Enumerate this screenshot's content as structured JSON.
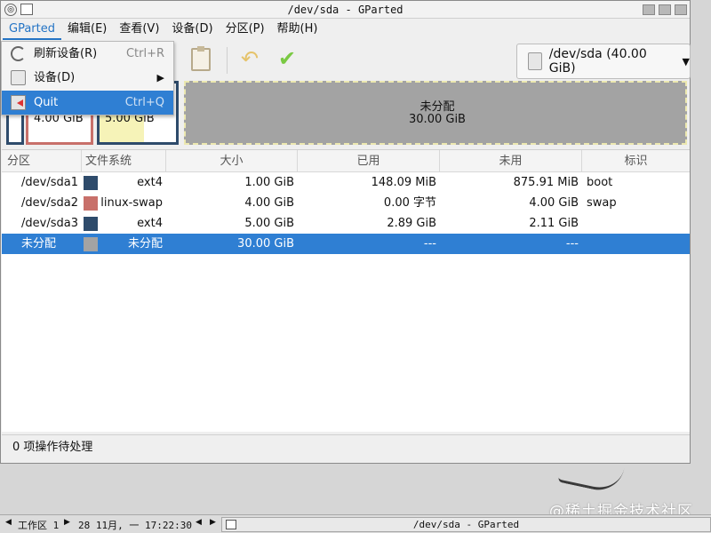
{
  "window": {
    "title": "/dev/sda - GParted"
  },
  "menubar": {
    "items": [
      "GParted",
      "编辑(E)",
      "查看(V)",
      "设备(D)",
      "分区(P)",
      "帮助(H)"
    ]
  },
  "gparted_menu": {
    "items": [
      {
        "label": "刷新设备(R)",
        "accel": "Ctrl+R",
        "icon": "refresh-icon"
      },
      {
        "label": "设备(D)",
        "accel": "",
        "icon": "device-icon",
        "submenu": "▶"
      },
      {
        "label": "Quit",
        "accel": "Ctrl+Q",
        "icon": "quit-icon"
      }
    ]
  },
  "toolbar": {
    "device_select": "/dev/sda (40.00 GiB)",
    "device_caret": "▼",
    "undo_icon": "↶",
    "apply_icon": "✔"
  },
  "disk_map": {
    "sda2_size": "4.00 GiB",
    "sda3_size": "5.00 GiB",
    "unallocated_label": "未分配",
    "unallocated_size": "30.00 GiB"
  },
  "table": {
    "headers": [
      "分区",
      "文件系统",
      "大小",
      "已用",
      "未用",
      "标识"
    ],
    "rows": [
      {
        "partition": "/dev/sda1",
        "fs_color": "#2e4b6b",
        "filesystem": "ext4",
        "size": "1.00 GiB",
        "used": "148.09 MiB",
        "unused": "875.91 MiB",
        "flags": "boot",
        "selected": false
      },
      {
        "partition": "/dev/sda2",
        "fs_color": "#c8706a",
        "filesystem": "linux-swap",
        "size": "4.00 GiB",
        "used": "0.00 字节",
        "unused": "4.00 GiB",
        "flags": "swap",
        "selected": false
      },
      {
        "partition": "/dev/sda3",
        "fs_color": "#2e4b6b",
        "filesystem": "ext4",
        "size": "5.00 GiB",
        "used": "2.89 GiB",
        "unused": "2.11 GiB",
        "flags": "",
        "selected": false
      },
      {
        "partition": "未分配",
        "fs_color": "#a3a3a3",
        "filesystem": "未分配",
        "size": "30.00 GiB",
        "used": "---",
        "unused": "---",
        "flags": "",
        "selected": true
      }
    ]
  },
  "status": {
    "text": "0 项操作待处理"
  },
  "taskbar": {
    "workspace": "工作区 1",
    "datetime": "28 11月, 一 17:22:30",
    "window_title": "/dev/sda - GParted",
    "nav_left": "◀",
    "nav_right": "▶"
  },
  "watermark": "@稀土掘金技术社区",
  "colors": {
    "selection": "#2f7fd3",
    "menu_active": "#2474c5",
    "ext4": "#2e4b6b",
    "linux_swap": "#c8706a",
    "unallocated": "#a3a3a3"
  }
}
